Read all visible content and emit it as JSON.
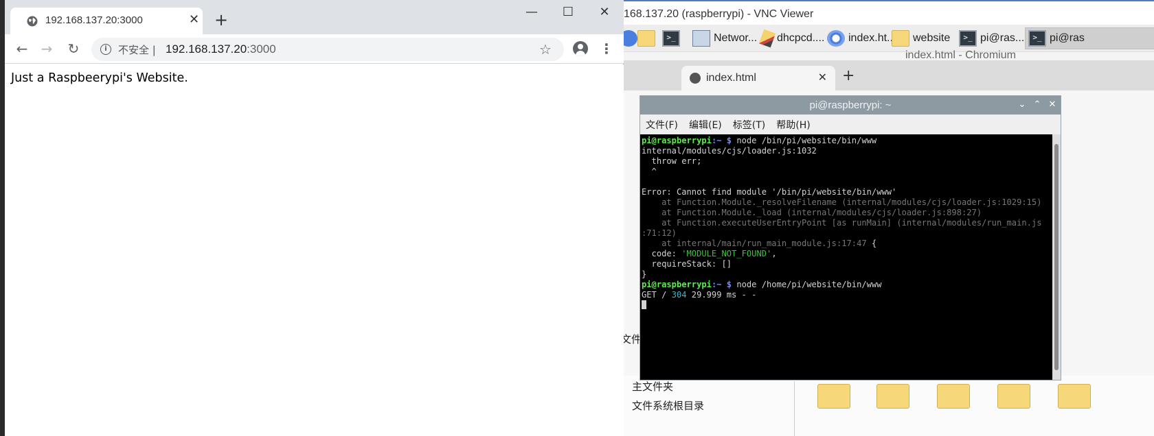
{
  "chrome": {
    "tab_title": "192.168.137.20:3000",
    "tab_close": "✕",
    "new_tab": "+",
    "window_controls": {
      "minimize": "—",
      "maximize": "☐",
      "close": "✕"
    },
    "security_label": "不安全",
    "security_sep": "|",
    "url_host": "192.168.137.20",
    "url_port": ":3000",
    "page_text": "Just a Raspbeerypi's Website."
  },
  "vnc": {
    "title": "168.137.20 (raspberrypi) - VNC Viewer",
    "taskbar": [
      {
        "label": "",
        "icon": "globe-icon"
      },
      {
        "label": "",
        "icon": "folder-icon"
      },
      {
        "label": "",
        "icon": "terminal-icon"
      },
      {
        "label": "Networ...",
        "icon": "network-icon"
      },
      {
        "label": "dhcpcd....",
        "icon": "pencil-icon"
      },
      {
        "label": "index.ht...",
        "icon": "chromium-icon"
      },
      {
        "label": "website",
        "icon": "folder-icon"
      },
      {
        "label": "pi@ras...",
        "icon": "terminal-icon"
      },
      {
        "label": "pi@ras",
        "icon": "terminal-icon"
      }
    ],
    "chromium_title": "index.html - Chromium",
    "inner_tab": "index.html",
    "inner_tab_close": "✕",
    "inner_new_tab": "+",
    "fm_menu_partial": "文件(",
    "fm_home": "主文件夹",
    "fm_root": "文件系统根目录"
  },
  "terminal": {
    "title": "pi@raspberrypi: ~",
    "menu": [
      "文件(F)",
      "编辑(E)",
      "标签(T)",
      "帮助(H)"
    ],
    "prompt_user": "pi@raspberrypi",
    "prompt_path": ":~ $",
    "cmd1": " node /bin/pi/website/bin/www",
    "lines_a": [
      "internal/modules/cjs/loader.js:1032",
      "  throw err;",
      "  ^",
      "",
      "Error: Cannot find module '/bin/pi/website/bin/www'"
    ],
    "stack": [
      "    at Function.Module._resolveFilename (internal/modules/cjs/loader.js:1029:15)",
      "    at Function.Module._load (internal/modules/cjs/loader.js:898:27)",
      "    at Function.executeUserEntryPoint [as runMain] (internal/modules/run_main.js",
      ":71:12)",
      "    at internal/main/run_main_module.js:17:47"
    ],
    "stack_brace": " {",
    "code_key": "  code: ",
    "code_val": "'MODULE_NOT_FOUND'",
    "code_comma": ",",
    "require_stack": "  requireStack: []",
    "close_brace": "}",
    "cmd2": " node /home/pi/website/bin/www",
    "get_a": "GET / ",
    "get_status": "304",
    "get_b": " 29.999 ms - -",
    "controls": {
      "minimize": "⌄",
      "maximize": "⌃",
      "close": "✕"
    }
  },
  "colors": {
    "chrome_tabstrip": "#dee1e6",
    "prompt_green": "#5cf04a",
    "prompt_blue": "#6b8cff",
    "string_green": "#3cc23c",
    "status_cyan": "#3ab8c8"
  }
}
